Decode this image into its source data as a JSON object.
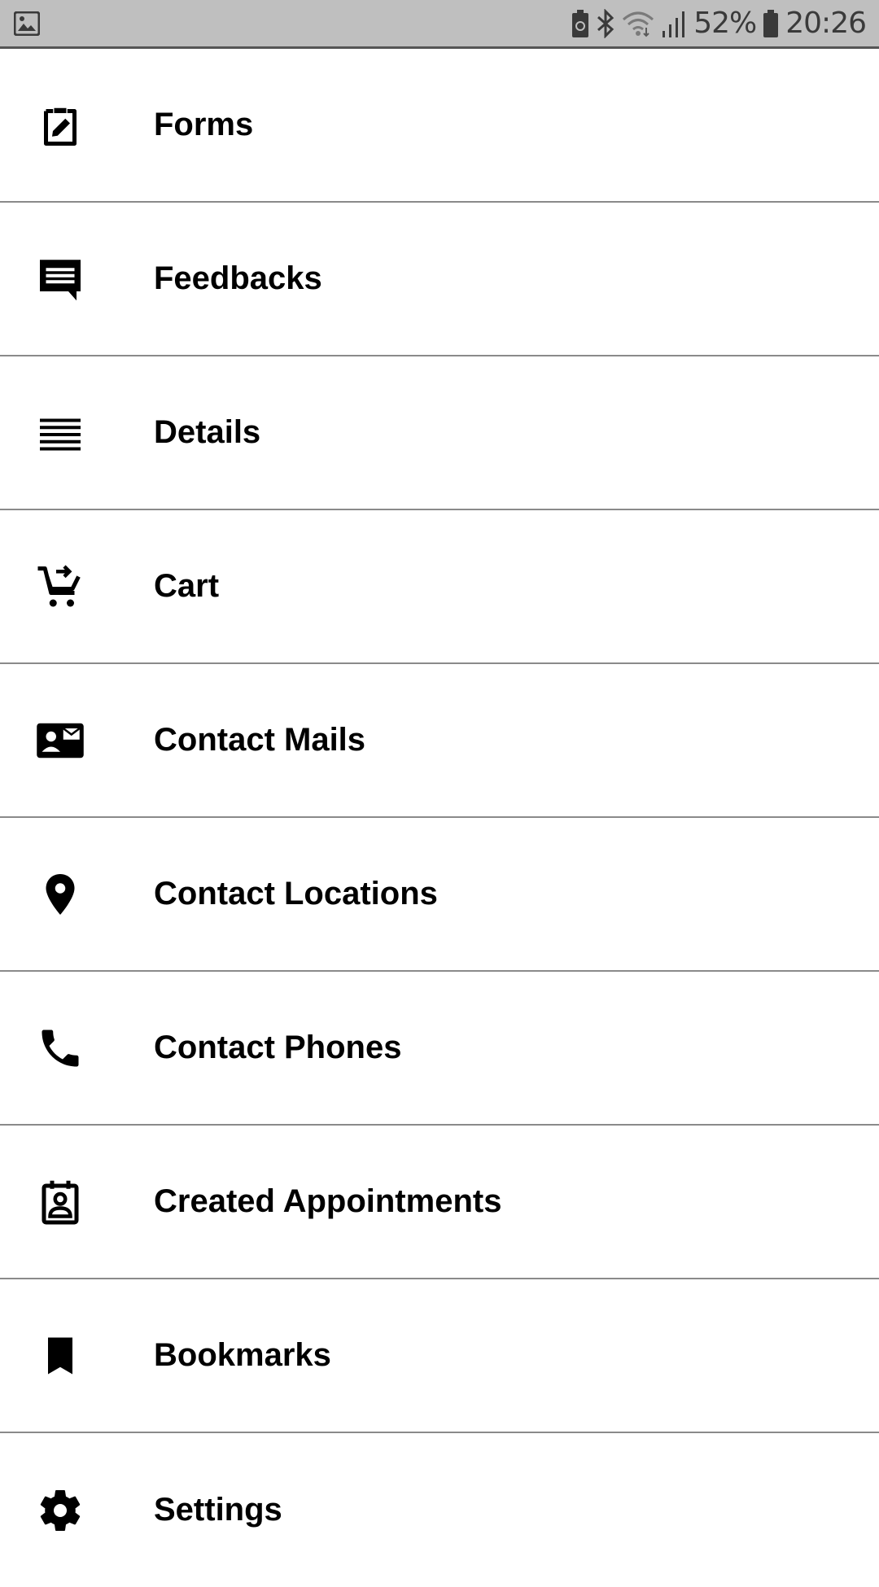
{
  "status_bar": {
    "battery_percent": "52%",
    "time": "20:26",
    "icons": [
      "gallery-icon",
      "battery-saver-icon",
      "bluetooth-icon",
      "wifi-icon",
      "signal-icon",
      "battery-icon"
    ]
  },
  "menu": {
    "items": [
      {
        "label": "Forms",
        "icon": "clipboard-edit-icon"
      },
      {
        "label": "Feedbacks",
        "icon": "feedback-icon"
      },
      {
        "label": "Details",
        "icon": "lines-icon"
      },
      {
        "label": "Cart",
        "icon": "cart-icon"
      },
      {
        "label": "Contact Mails",
        "icon": "contact-mail-icon"
      },
      {
        "label": "Contact Locations",
        "icon": "location-pin-icon"
      },
      {
        "label": "Contact Phones",
        "icon": "phone-icon"
      },
      {
        "label": "Created Appointments",
        "icon": "contact-calendar-icon"
      },
      {
        "label": "Bookmarks",
        "icon": "bookmark-icon"
      },
      {
        "label": "Settings",
        "icon": "gear-icon"
      }
    ]
  },
  "colors": {
    "status_bar_bg": "#bfbfbf",
    "divider": "#8a8a8a",
    "text": "#000000"
  }
}
